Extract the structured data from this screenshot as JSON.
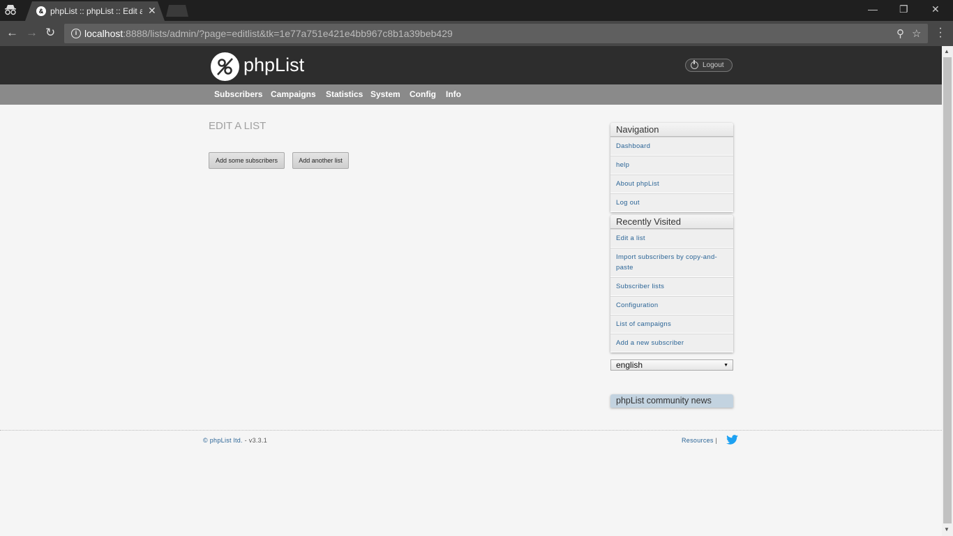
{
  "browser": {
    "tab_title": "phpList :: phpList :: Edit a list",
    "url_host": "localhost",
    "url_rest": ":8888/lists/admin/?page=editlist&tk=1e77a751e421e4bb967c8b1a39beb429"
  },
  "header": {
    "logo_text": "phpList",
    "logout_label": "Logout"
  },
  "menu": {
    "items": [
      "Subscribers",
      "Campaigns",
      "Statistics",
      "System",
      "Config",
      "Info"
    ]
  },
  "main": {
    "title": "EDIT A LIST",
    "buttons": [
      "Add some subscribers",
      "Add another list"
    ]
  },
  "sidebar": {
    "navigation": {
      "title": "Navigation",
      "links": [
        "Dashboard",
        "help",
        "About phpList",
        "Log out"
      ]
    },
    "recent": {
      "title": "Recently Visited",
      "links": [
        "Edit a list",
        "Import subscribers by copy-and-paste",
        "Subscriber lists",
        "Configuration",
        "List of campaigns",
        "Add a new subscriber"
      ]
    },
    "language": "english",
    "news_title": "phpList community news"
  },
  "footer": {
    "copyright_link": "© phpList ltd.",
    "version": " - v3.3.1",
    "resources": "Resources",
    "separator": "|"
  },
  "colors": {
    "link": "#2a6496",
    "header_bg": "#2d2d2d",
    "menu_bg": "#8a8a8a",
    "twitter": "#1da1f2"
  }
}
